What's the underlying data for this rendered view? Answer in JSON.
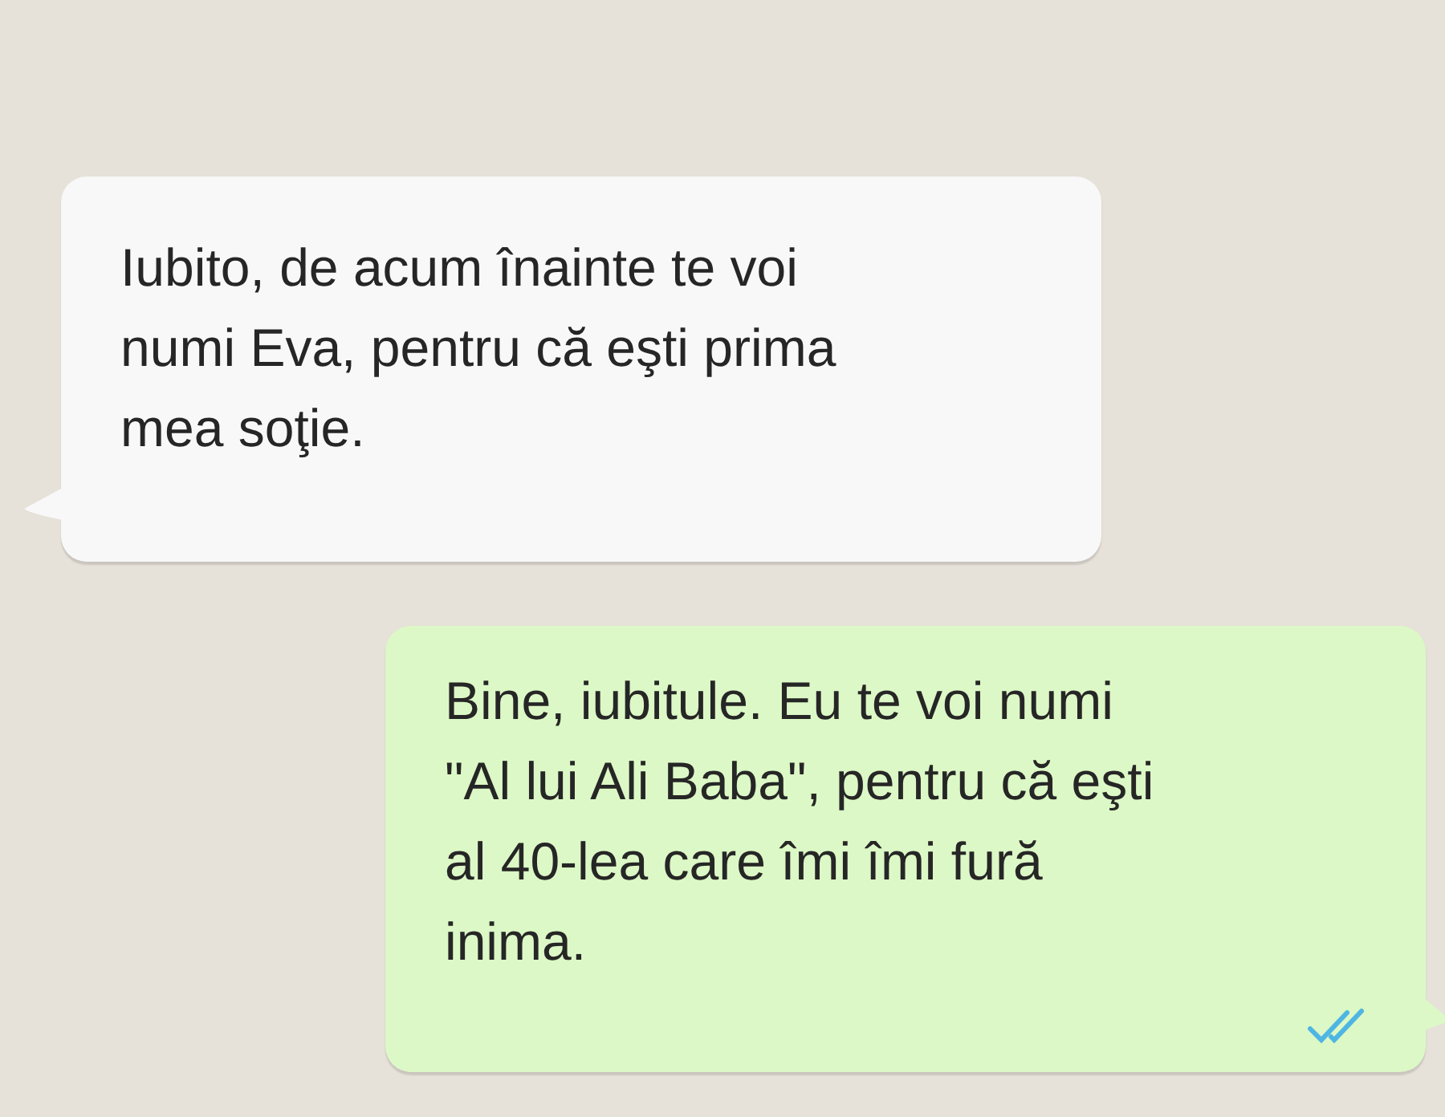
{
  "messages": [
    {
      "kind": "incoming",
      "lines": [
        "Iubito, de acum înainte te voi",
        "numi Eva, pentru că eşti prima",
        "mea soţie."
      ]
    },
    {
      "kind": "outgoing",
      "lines": [
        "Bine, iubitule. Eu te voi numi",
        "\"Al lui Ali Baba\", pentru că eşti",
        "al 40-lea care îmi îmi fură",
        "inima."
      ],
      "read": true
    }
  ]
}
